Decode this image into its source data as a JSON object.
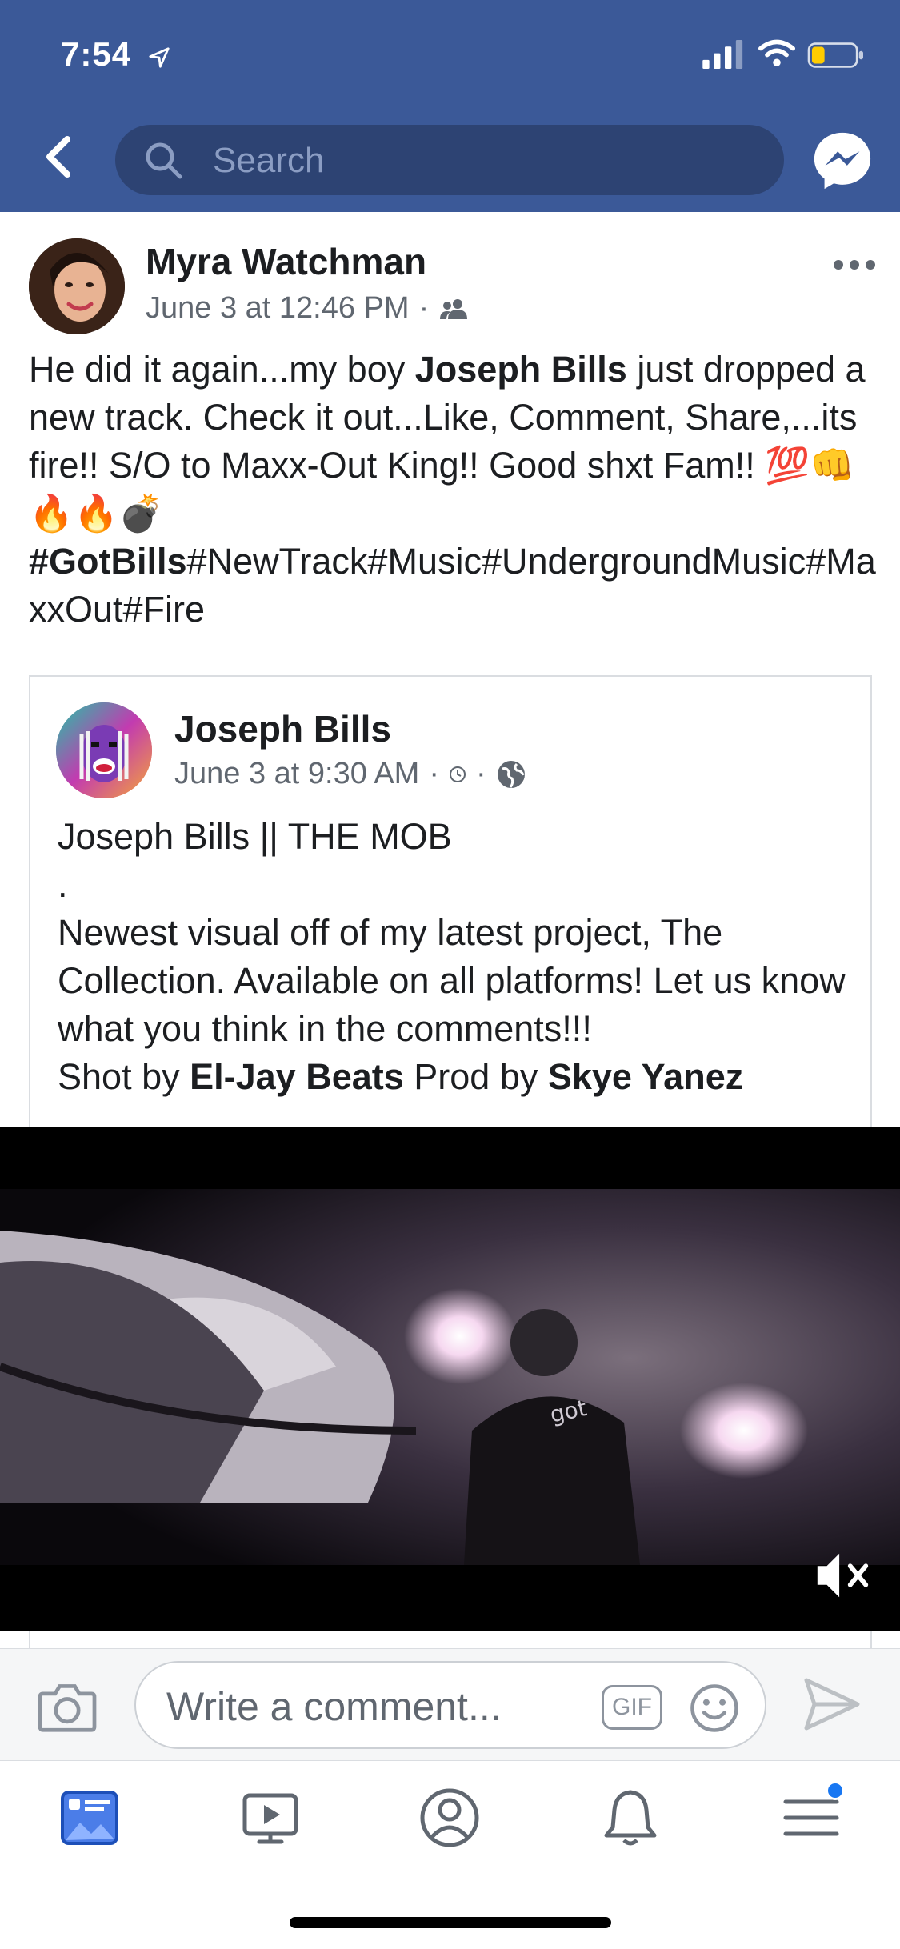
{
  "status_bar": {
    "time": "7:54"
  },
  "nav": {
    "search_placeholder": "Search"
  },
  "post": {
    "author": "Myra Watchman",
    "timestamp": "June 3 at 12:46 PM",
    "separator": "·",
    "text": {
      "line1_a": "He did it again...my boy ",
      "line1_b": "Joseph Bills",
      "line1_c": " just dropped a new track. Check it out...Like, Comment, Share,...its fire!! S/O to Maxx-Out King!! Good shxt Fam!! ",
      "emojis": "💯👊🔥🔥💣",
      "hashtag_bold": "#GotBills",
      "hashtags": "#NewTrack#Music#UndergroundMusic#MaxxOut#Fire"
    }
  },
  "shared_post": {
    "author": "Joseph Bills",
    "timestamp": "June 3 at 9:30 AM",
    "separator": "·",
    "title": "Joseph Bills || THE MOB",
    "dot": ".",
    "body": "Newest visual off of my latest project, The Collection. Available on all platforms! Let us know what you think in the comments!!!",
    "credit_prefix": "Shot by ",
    "credit_shot": "El-Jay Beats",
    "credit_mid": " Prod by ",
    "credit_prod": "Skye Yanez"
  },
  "comment_bar": {
    "placeholder": "Write a comment...",
    "gif_label": "GIF"
  },
  "colors": {
    "brand": "#3b5998",
    "search_bg": "#2d4373",
    "accent_dot": "#1877f2"
  },
  "icons": [
    "back-arrow-icon",
    "search-icon",
    "messenger-icon",
    "more-icon",
    "friends-icon",
    "clock-icon",
    "globe-icon",
    "mute-icon",
    "camera-icon",
    "emoji-icon",
    "send-icon",
    "news-feed-icon",
    "watch-icon",
    "profile-icon",
    "bell-icon",
    "menu-icon"
  ]
}
